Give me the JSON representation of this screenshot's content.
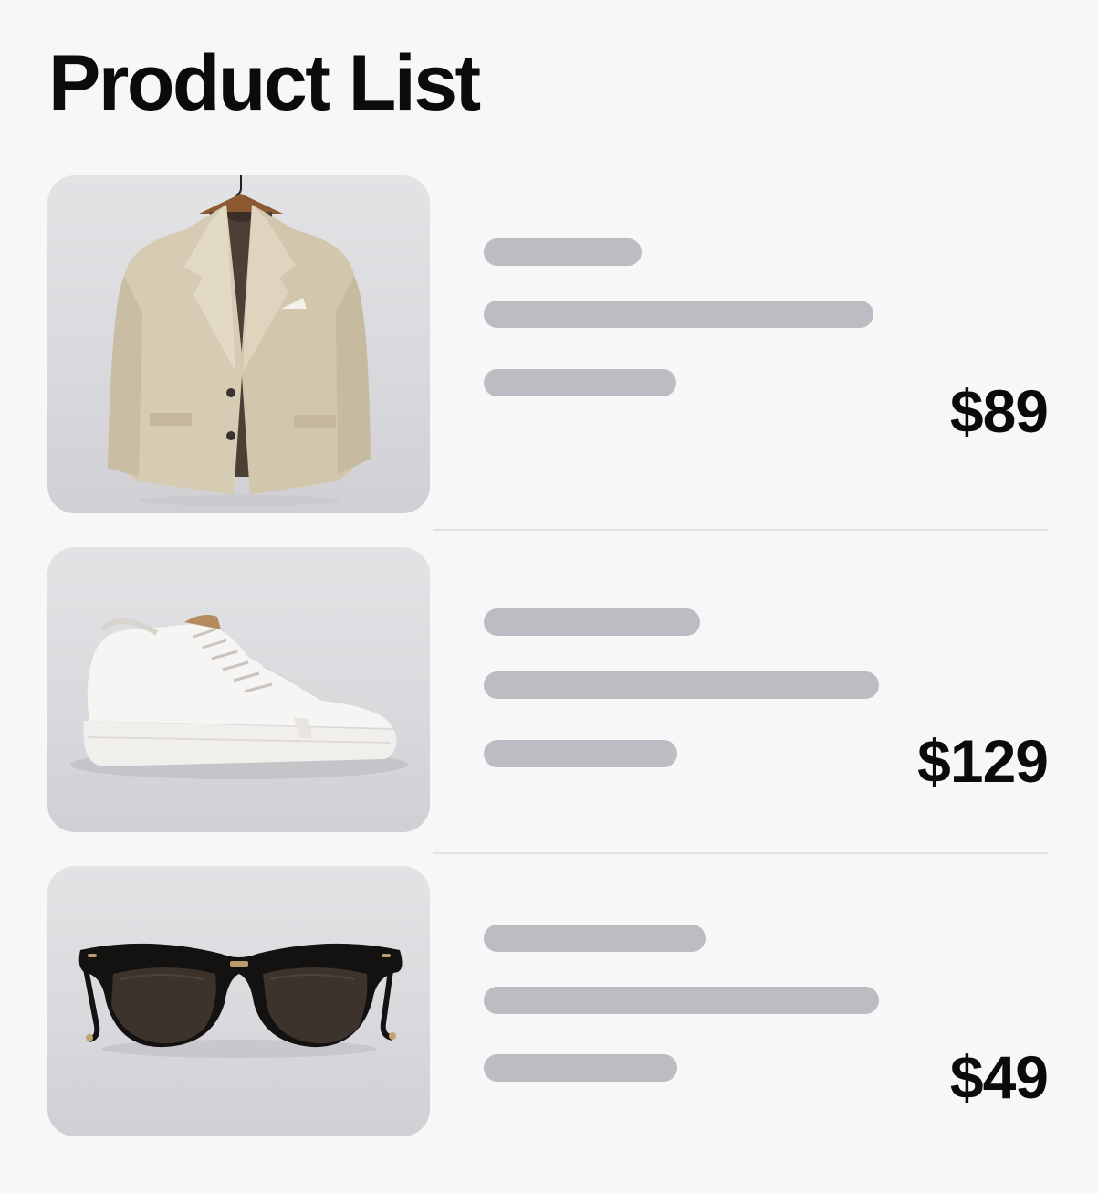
{
  "title": "Product List",
  "products": [
    {
      "image_icon": "blazer-icon",
      "price": "$89"
    },
    {
      "image_icon": "sneaker-icon",
      "price": "$129"
    },
    {
      "image_icon": "sunglasses-icon",
      "price": "$49"
    }
  ],
  "colors": {
    "background": "#f7f7f8",
    "skeleton": "#bdbcc2",
    "text": "#0b0b0b",
    "divider": "#e2e2e5"
  }
}
